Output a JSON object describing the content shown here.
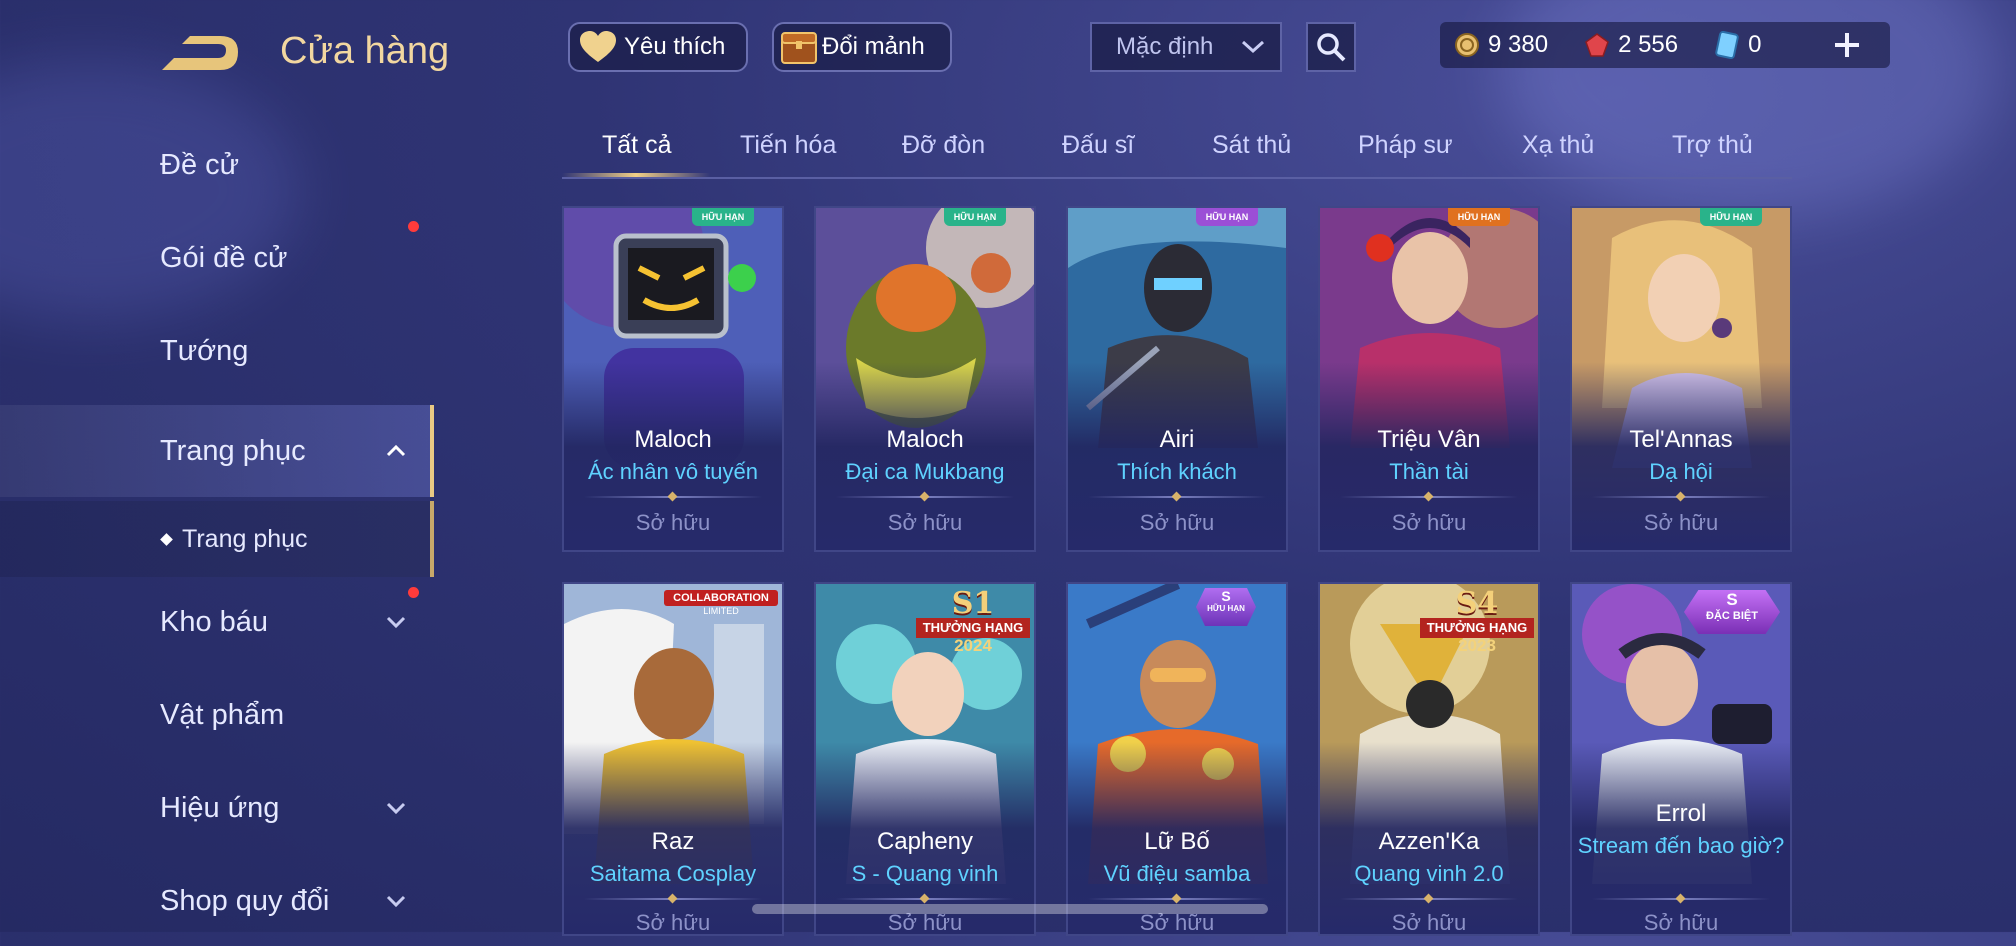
{
  "header": {
    "title": "Cửa hàng",
    "favorites_label": "Yêu thích",
    "exchange_label": "Đổi mảnh",
    "sort": {
      "selected": "Mặc định"
    },
    "currencies": [
      {
        "name": "gold-coin-icon",
        "value": "9 380"
      },
      {
        "name": "ruby-icon",
        "value": "2 556"
      },
      {
        "name": "voucher-icon",
        "value": "0"
      }
    ]
  },
  "sidebar": {
    "items": [
      {
        "label": "Đề cử"
      },
      {
        "label": "Gói đề cử"
      },
      {
        "label": "Tướng"
      },
      {
        "label": "Trang phục"
      },
      {
        "label": "Trang phục"
      },
      {
        "label": "Kho báu"
      },
      {
        "label": "Vật phẩm"
      },
      {
        "label": "Hiệu ứng"
      },
      {
        "label": "Shop quy đổi"
      }
    ]
  },
  "tabs": [
    "Tất cả",
    "Tiến hóa",
    "Đỡ đòn",
    "Đấu sĩ",
    "Sát thủ",
    "Pháp sư",
    "Xạ thủ",
    "Trợ thủ"
  ],
  "cards": [
    {
      "hero": "Maloch",
      "skin": "Ác nhân vô tuyến",
      "status": "Sở hữu",
      "badge": "HỮU HẠN",
      "badge_color": "#29b38a"
    },
    {
      "hero": "Maloch",
      "skin": "Đại ca Mukbang",
      "status": "Sở hữu",
      "badge": "HỮU HẠN",
      "badge_color": "#29b38a"
    },
    {
      "hero": "Airi",
      "skin": "Thích khách",
      "status": "Sở hữu",
      "badge": "HỮU HẠN",
      "badge_color": "#9b4fd6"
    },
    {
      "hero": "Triệu Vân",
      "skin": "Thần tài",
      "status": "Sở hữu",
      "badge": "HỮU HẠN",
      "badge_color": "#e0711f"
    },
    {
      "hero": "Tel'Annas",
      "skin": "Dạ hội",
      "status": "Sở hữu",
      "badge": "HỮU HẠN",
      "badge_color": "#29b38a"
    },
    {
      "hero": "Raz",
      "skin": "Saitama Cosplay",
      "status": "Sở hữu",
      "collab1": "COLLABORATION",
      "collab2": "LIMITED"
    },
    {
      "hero": "Capheny",
      "skin": "S - Quang vinh",
      "status": "Sở hữu",
      "rank_s": "S1",
      "rank_label": "THƯỞNG HẠNG",
      "rank_year": "2024"
    },
    {
      "hero": "Lữ Bố",
      "skin": "Vũ điệu samba",
      "status": "Sở hữu",
      "badge_s": "S",
      "badge_label": "HỮU HẠN"
    },
    {
      "hero": "Azzen'Ka",
      "skin": "Quang vinh 2.0",
      "status": "Sở hữu",
      "rank_s": "S4",
      "rank_label": "THƯỞNG HẠNG",
      "rank_year": "2023"
    },
    {
      "hero": "Errol",
      "skin": "Stream đến bao giờ?",
      "status": "Sở hữu",
      "badge_s": "S",
      "badge_label": "ĐẶC BIỆT"
    }
  ],
  "colors": {
    "accent_gold": "#f2d7a0",
    "skin_name": "#5fd2ff",
    "owned_text": "#8d92c8",
    "notification": "#ff3b3b"
  }
}
